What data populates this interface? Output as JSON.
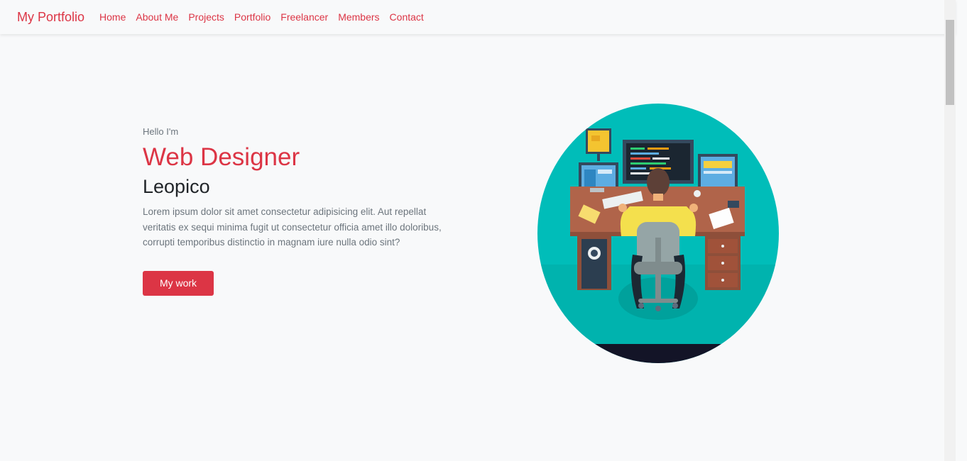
{
  "navbar": {
    "brand": "My Portfolio",
    "links": [
      "Home",
      "About Me",
      "Projects",
      "Portfolio",
      "Freelancer",
      "Members",
      "Contact"
    ]
  },
  "hero": {
    "greeting": "Hello I'm",
    "role": "Web Designer",
    "name": "Leopico",
    "description": "Lorem ipsum dolor sit amet consectetur adipisicing elit. Aut repellat veritatis ex sequi minima fugit ut consectetur officia amet illo doloribus, corrupti temporibus distinctio in magnam iure nulla odio sint?",
    "button_label": "My work"
  },
  "colors": {
    "accent": "#dc3545",
    "background": "#f8f9fa",
    "illustration_bg": "#00bdb9"
  },
  "icons": {
    "hero_image": "developer-at-desk-illustration"
  }
}
